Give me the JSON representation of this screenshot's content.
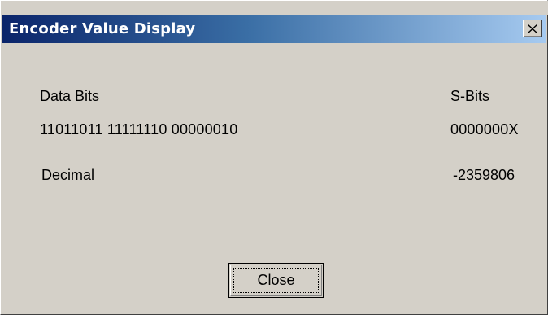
{
  "window": {
    "title": "Encoder Value Display",
    "close_glyph": "✕",
    "close_icon": "close-icon"
  },
  "fields": {
    "data_bits_label": "Data Bits",
    "data_bits_value": "11011011 11111110 00000010",
    "s_bits_label": "S-Bits",
    "s_bits_value": "0000000X",
    "decimal_label": "Decimal",
    "decimal_value": "-2359806"
  },
  "buttons": {
    "close_label": "Close"
  },
  "colors": {
    "dialog_face": "#d4d0c8",
    "titlebar_start": "#0a246a",
    "titlebar_end": "#a6caf0",
    "title_text": "#ffffff"
  }
}
